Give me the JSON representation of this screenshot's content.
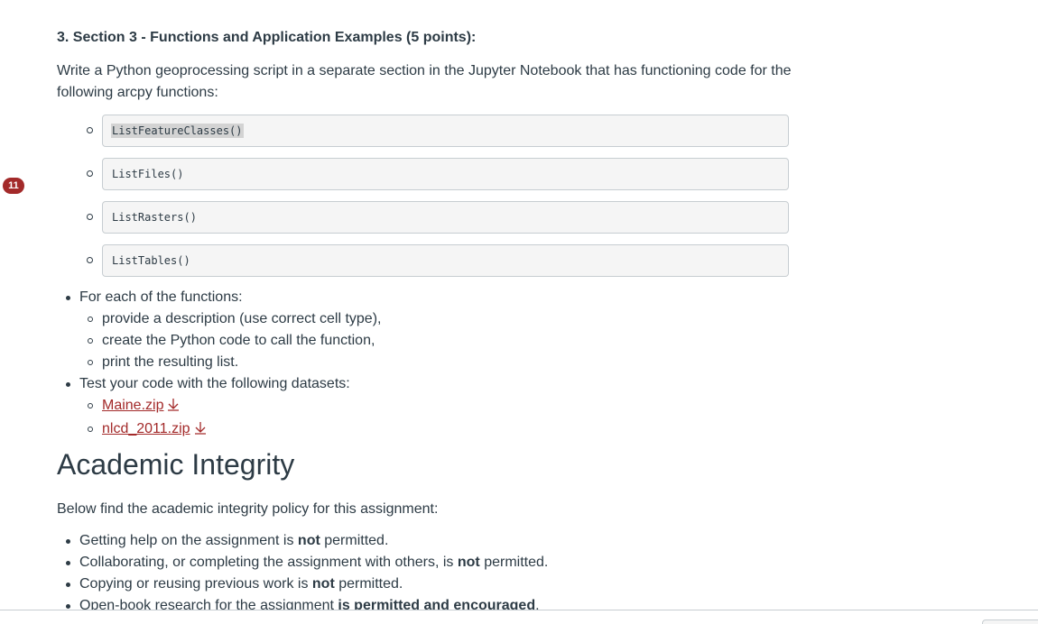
{
  "badge": {
    "count": "11"
  },
  "section": {
    "heading": "3. Section 3 - Functions and Application Examples (5 points):",
    "intro": "Write a Python geoprocessing script in a separate section in the Jupyter Notebook that has functioning code for the following arcpy functions:",
    "functions": [
      "ListFeatureClasses()",
      "ListFiles()",
      "ListRasters()",
      "ListTables()"
    ]
  },
  "instructions": {
    "for_each": "For each of the functions:",
    "steps": [
      "provide a description (use correct cell type),",
      "create the Python code to call the function,",
      "print the resulting list."
    ],
    "test": "Test your code with the following datasets:",
    "datasets": [
      "Maine.zip",
      "nlcd_2011.zip"
    ]
  },
  "integrity": {
    "heading": "Academic Integrity",
    "intro": "Below find the academic integrity policy for this assignment:",
    "items": [
      {
        "pre": "Getting help on the assignment is ",
        "bold": "not",
        "post": " permitted."
      },
      {
        "pre": "Collaborating, or completing the assignment with others, is ",
        "bold": "not",
        "post": " permitted."
      },
      {
        "pre": "Copying or reusing previous work is ",
        "bold": "not",
        "post": " permitted."
      },
      {
        "pre": "Open-book research for the assignment ",
        "bold": "is permitted and encouraged",
        "post": "."
      }
    ]
  },
  "colors": {
    "text": "#2d3b45",
    "link": "#a32a2a",
    "badge": "#a32a2a",
    "code_bg": "#f5f5f5",
    "border": "#c7cdd1"
  }
}
